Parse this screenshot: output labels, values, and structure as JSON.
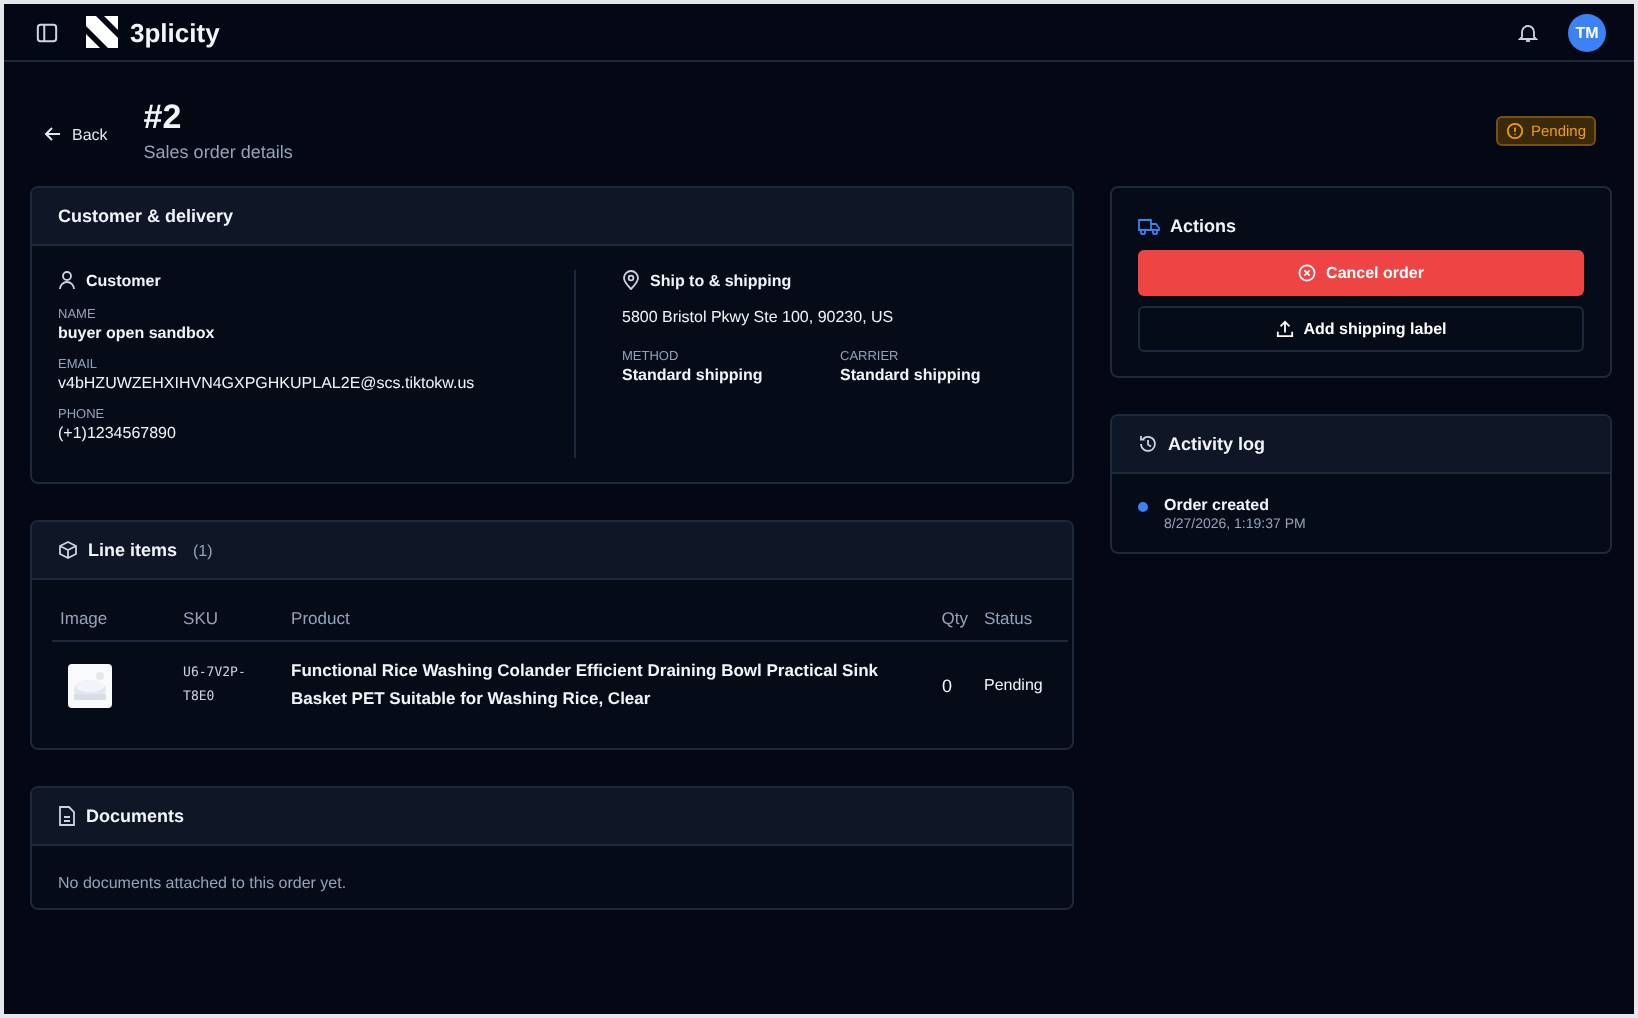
{
  "app": {
    "brand": "3plicity",
    "avatar": "TM"
  },
  "header": {
    "back": "Back",
    "title": "#2",
    "subtitle": "Sales order details",
    "status": "Pending"
  },
  "customer_delivery": {
    "title": "Customer & delivery",
    "customer": {
      "heading": "Customer",
      "fields": [
        {
          "label": "NAME",
          "value": "buyer open sandbox",
          "kind": "bold"
        },
        {
          "label": "EMAIL",
          "value": "v4bHZUWZEHXIHVN4GXPGHKUPLAL2E@scs.tiktokw.us",
          "kind": "plain"
        },
        {
          "label": "PHONE",
          "value": "(+1)1234567890",
          "kind": "plain"
        }
      ]
    },
    "shipping": {
      "heading": "Ship to & shipping",
      "address": "5800 Bristol Pkwy Ste 100, 90230, US",
      "fields": [
        {
          "label": "METHOD",
          "value": "Standard shipping"
        },
        {
          "label": "CARRIER",
          "value": "Standard shipping"
        }
      ]
    }
  },
  "line_items": {
    "title": "Line items",
    "count": "(1)",
    "columns": [
      "Image",
      "SKU",
      "Product",
      "Qty",
      "Status"
    ],
    "rows": [
      {
        "sku": "U6-7V2P-T8E0",
        "product": "Functional Rice Washing Colander Efficient Draining Bowl Practical Sink Basket PET Suitable for Washing Rice, Clear",
        "qty": "0",
        "status": "Pending"
      }
    ]
  },
  "documents": {
    "title": "Documents",
    "empty": "No documents attached to this order yet."
  },
  "actions": {
    "title": "Actions",
    "buttons": [
      {
        "label": "Cancel order",
        "kind": "danger"
      },
      {
        "label": "Add shipping label",
        "kind": "outline"
      }
    ]
  },
  "activity_log": {
    "title": "Activity log",
    "entries": [
      {
        "title": "Order created",
        "time": "8/27/2026, 1:19:37 PM",
        "color": "#3b82f6"
      }
    ]
  }
}
